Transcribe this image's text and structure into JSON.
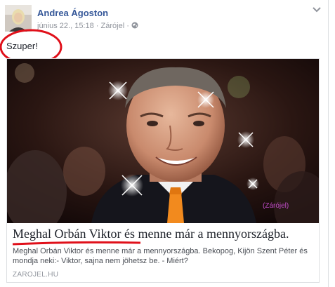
{
  "post": {
    "author": "Andrea Ágoston",
    "date": "június 22., 15:18",
    "separator": "·",
    "group": "Zárójel",
    "text": "Szuper!"
  },
  "link": {
    "title": "Meghal Orbán Viktor és menne már a mennyországba.",
    "description": "Meghal Orbán Viktor és menne már a mennyországba. Bekopog, Kijön Szent Péter és mondja neki:- Viktor, sajna nem jöhetsz be. - Miért?",
    "domain": "ZAROJEL.HU",
    "watermark": "(Zárójel)"
  },
  "colors": {
    "author": "#365899",
    "annotation": "#e0101a",
    "watermark": "#c04cc8"
  }
}
